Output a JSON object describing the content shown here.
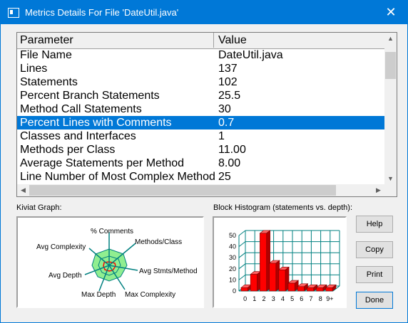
{
  "window": {
    "title": "Metrics Details For File 'DateUtil.java'",
    "close_glyph": "✕"
  },
  "background_strip": [
    "8",
    "3",
    "5",
    "3"
  ],
  "table": {
    "headers": [
      "Parameter",
      "Value"
    ],
    "rows": [
      {
        "param": "File Name",
        "value": "DateUtil.java",
        "selected": false
      },
      {
        "param": "Lines",
        "value": "137",
        "selected": false
      },
      {
        "param": "Statements",
        "value": "102",
        "selected": false
      },
      {
        "param": "Percent Branch Statements",
        "value": "25.5",
        "selected": false
      },
      {
        "param": "Method Call Statements",
        "value": "30",
        "selected": false
      },
      {
        "param": "Percent Lines with Comments",
        "value": "0.7",
        "selected": true
      },
      {
        "param": "Classes and Interfaces",
        "value": "1",
        "selected": false
      },
      {
        "param": "Methods per Class",
        "value": "11.00",
        "selected": false
      },
      {
        "param": "Average Statements per Method",
        "value": "8.00",
        "selected": false
      },
      {
        "param": "Line Number of Most Complex Method",
        "value": "25",
        "selected": false
      }
    ]
  },
  "kiviat": {
    "label": "Kiviat Graph:",
    "axes": [
      "% Comments",
      "Methods/Class",
      "Avg Stmts/Method",
      "Max Complexity",
      "Max Depth",
      "Avg Depth",
      "Avg Complexity"
    ]
  },
  "histogram": {
    "label": "Block Histogram (statements vs. depth):",
    "y_ticks": [
      "50",
      "40",
      "30",
      "20",
      "10",
      "0"
    ],
    "categories": [
      "0",
      "1",
      "2",
      "3",
      "4",
      "5",
      "6",
      "7",
      "8",
      "9+"
    ],
    "values": [
      3,
      15,
      52,
      25,
      19,
      7,
      4,
      3,
      3,
      3
    ],
    "ylim": [
      0,
      50
    ],
    "bar_color": "#ff0000",
    "grid_color": "#008080"
  },
  "buttons": {
    "help": "Help",
    "copy": "Copy",
    "print": "Print",
    "done": "Done"
  },
  "colors": {
    "accent": "#0078d7",
    "kiviat_fill": "#90ee90"
  }
}
